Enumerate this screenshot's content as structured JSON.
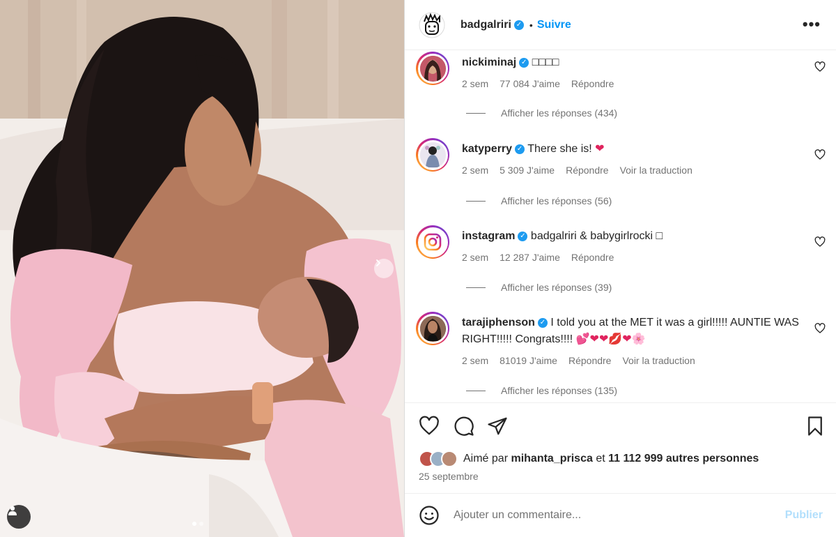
{
  "post": {
    "author": "badgalriri",
    "follow_label": "Suivre",
    "separator": "•",
    "more_label": "•••",
    "slides_total": 2,
    "slide_active": 1
  },
  "comments": [
    {
      "user": "nickiminaj",
      "text": "□□□□",
      "time": "2 sem",
      "likes": "77 084 J'aime",
      "reply_label": "Répondre",
      "translate_label": "",
      "view_replies": "Afficher les réponses (434)"
    },
    {
      "user": "katyperry",
      "text": "There she is!",
      "emoji": "❤",
      "time": "2 sem",
      "likes": "5 309 J'aime",
      "reply_label": "Répondre",
      "translate_label": "Voir la traduction",
      "view_replies": "Afficher les réponses (56)"
    },
    {
      "user": "instagram",
      "text": "badgalriri & babygirlrocki □",
      "time": "2 sem",
      "likes": "12 287 J'aime",
      "reply_label": "Répondre",
      "translate_label": "",
      "view_replies": "Afficher les réponses (39)"
    },
    {
      "user": "tarajiphenson",
      "text": "I told you at the MET it was a girl!!!!! AUNTIE WAS RIGHT!!!!! Congrats!!!!",
      "emoji": "💕❤❤💋❤🌸",
      "time": "2 sem",
      "likes": "81019 J'aime",
      "reply_label": "Répondre",
      "translate_label": "Voir la traduction",
      "view_replies": "Afficher les réponses (135)"
    }
  ],
  "likes": {
    "prefix": "Aimé par",
    "user": "mihanta_prisca",
    "connector": "et",
    "count": "11 112 999 autres personnes"
  },
  "date": "25 septembre",
  "add_comment": {
    "placeholder": "Ajouter un commentaire...",
    "publish_label": "Publier"
  },
  "colors": {
    "accent": "#0095f6",
    "verified": "#1d9bf0",
    "publish_disabled": "#b2dffc",
    "muted_text": "#737373",
    "heart": "#e0245e"
  },
  "icons": {
    "like": "heart-outline-icon",
    "comment": "comment-bubble-icon",
    "share": "paper-plane-icon",
    "save": "bookmark-icon",
    "emoji": "smiley-icon",
    "next": "chevron-right-icon",
    "tag": "person-tag-icon"
  }
}
